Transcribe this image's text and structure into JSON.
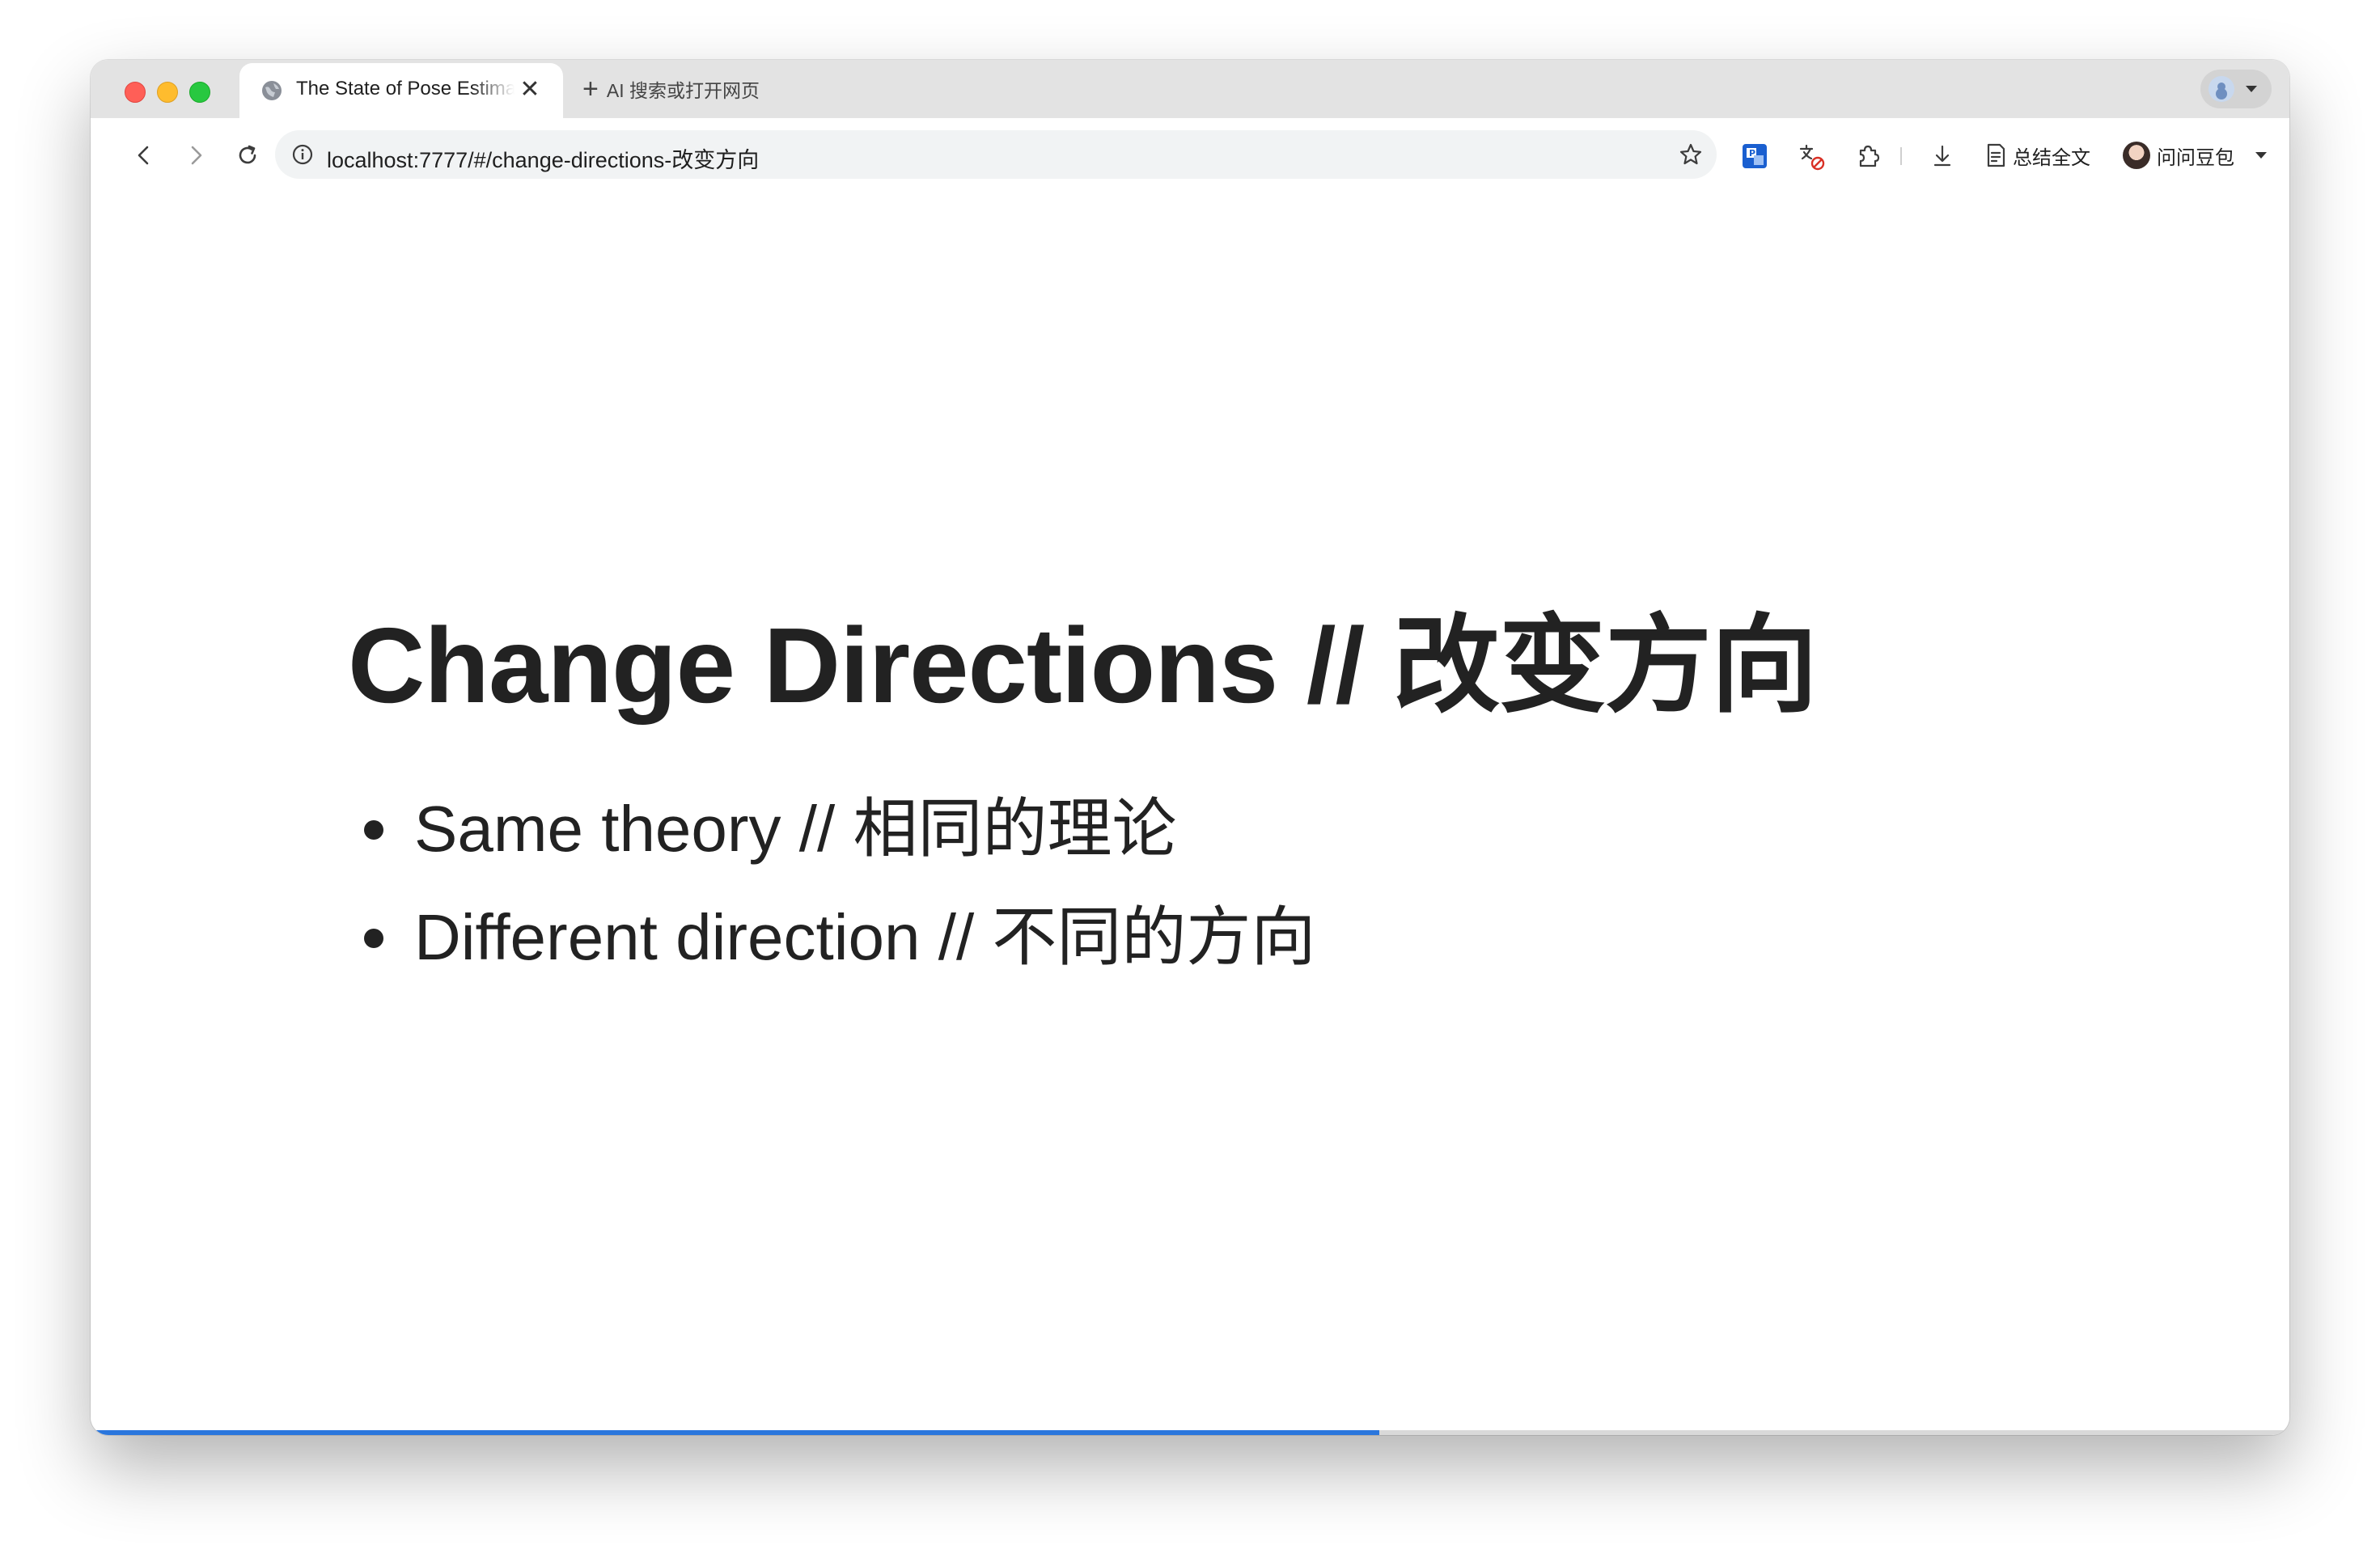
{
  "browser": {
    "tab": {
      "title": "The State of Pose Estimation",
      "close_glyph": "✕"
    },
    "new_tab": {
      "plus_glyph": "+",
      "label": "AI 搜索或打开网页"
    },
    "address": "localhost:7777/#/change-directions-改变方向",
    "toolbar": {
      "summary_label": "总结全文",
      "doubao_label": "问问豆包"
    },
    "icons": {
      "back": "back-arrow-icon",
      "forward": "forward-arrow-icon",
      "reload": "reload-icon",
      "info": "info-icon",
      "star": "bookmark-star-icon",
      "extension_1": "translate-extension-icon",
      "extension_2": "translate-blocked-icon",
      "extensions": "puzzle-icon",
      "download": "download-icon",
      "summary": "document-icon"
    },
    "colors": {
      "accent": "#2a76dd",
      "tabbar": "#e3e3e3"
    }
  },
  "slide": {
    "title": "Change Directions // 改变方向",
    "bullets": [
      {
        "text": "Same theory // 相同的理论"
      },
      {
        "text": "Different direction // 不同的方向"
      }
    ],
    "progress": 0.586
  }
}
